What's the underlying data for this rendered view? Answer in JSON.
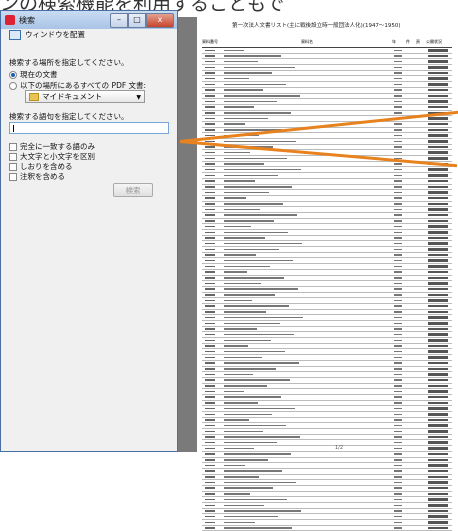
{
  "caption": "ンの検索機能を利用することもで",
  "dialog": {
    "title": "検索",
    "minimize_symbol": "–",
    "maximize_symbol": "□",
    "close_symbol": "x",
    "arrange_windows": "ウィンドウを配置",
    "location_prompt": "検索する場所を指定してください。",
    "option_current": "現在の文書",
    "option_all_pdf": "以下の場所にあるすべての PDF 文書:",
    "location_value": "マイドキュメント",
    "term_prompt": "検索する語句を指定してください。",
    "term_value": "",
    "options": [
      {
        "label": "完全に一致する語のみ",
        "checked": false
      },
      {
        "label": "大文字と小文字を区別",
        "checked": false
      },
      {
        "label": "しおりを含める",
        "checked": false
      },
      {
        "label": "注釈を含める",
        "checked": false
      }
    ],
    "search_button": "検索"
  },
  "document": {
    "title": "第一次法人文書リスト(主に戦後設立時一般団法人化)(1947〜1950)",
    "table_header": [
      "資料番号",
      "資料名",
      "年",
      "件",
      "頁",
      "公開状況"
    ],
    "footer": "1/2"
  }
}
